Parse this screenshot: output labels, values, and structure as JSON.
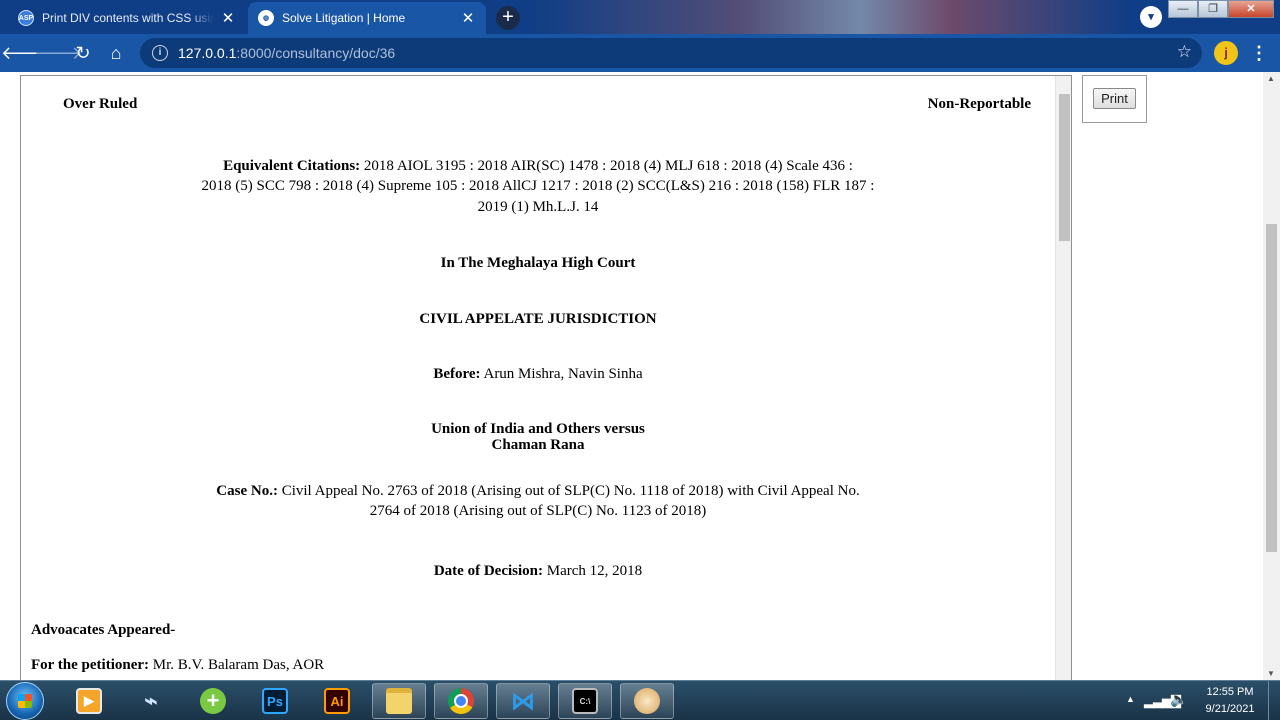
{
  "browser": {
    "tabs": [
      {
        "title": "Print DIV contents with CSS using",
        "favicon_text": "ASP",
        "close": "✕"
      },
      {
        "title": "Solve Litigation | Home",
        "close": "✕"
      }
    ],
    "new_tab": "+",
    "url_host": "127.0.0.1",
    "url_path": ":8000/consultancy/doc/36",
    "avatar_letter": "j",
    "window_buttons": {
      "minimize": "—",
      "maximize": "❐",
      "close": "✕"
    }
  },
  "icons": {
    "back": "back-arrow-icon",
    "forward": "forward-arrow-icon",
    "reload": "reload-icon",
    "home": "home-icon",
    "info": "info-icon",
    "star": "star-icon",
    "menu": "kebab-menu-icon"
  },
  "document": {
    "top_left": "Over Ruled",
    "top_right": "Non-Reportable",
    "citations_label": "Equivalent Citations:",
    "citations_line1": "2018 AIOL 3195 : 2018 AIR(SC) 1478 : 2018 (4) MLJ 618 : 2018 (4) Scale 436 :",
    "citations_line2": "2018 (5) SCC 798 : 2018 (4) Supreme 105 : 2018 AllCJ 1217 : 2018 (2) SCC(L&S) 216 : 2018 (158) FLR 187 :",
    "citations_line3": "2019 (1) Mh.L.J. 14",
    "court": "In The Meghalaya High Court",
    "jurisdiction": "CIVIL APPELATE JURISDICTION",
    "before_label": "Before:",
    "before_value": "Arun Mishra, Navin Sinha",
    "parties_line1": "Union of India and Others versus",
    "parties_line2": "Chaman Rana",
    "case_label": "Case No.:",
    "case_line1": "Civil Appeal No. 2763 of 2018 (Arising out of SLP(C) No. 1118 of 2018) with Civil Appeal No.",
    "case_line2": "2764 of 2018 (Arising out of SLP(C) No. 1123 of 2018)",
    "decision_label": "Date of Decision:",
    "decision_value": "March 12, 2018",
    "advocates_heading": "Advoacates Appeared-",
    "petitioner_label": "For the petitioner:",
    "petitioner_value": "Mr. B.V. Balaram Das, AOR"
  },
  "print_button": "Print",
  "taskbar": {
    "apps": [
      "media-player",
      "usb-tool",
      "plus-app",
      "photoshop",
      "illustrator",
      "file-explorer",
      "chrome",
      "vscode",
      "command-prompt",
      "paint"
    ],
    "ps_label": "Ps",
    "ai_label": "Ai",
    "cmd_label": "C:\\",
    "time": "12:55 PM",
    "date": "9/21/2021"
  }
}
